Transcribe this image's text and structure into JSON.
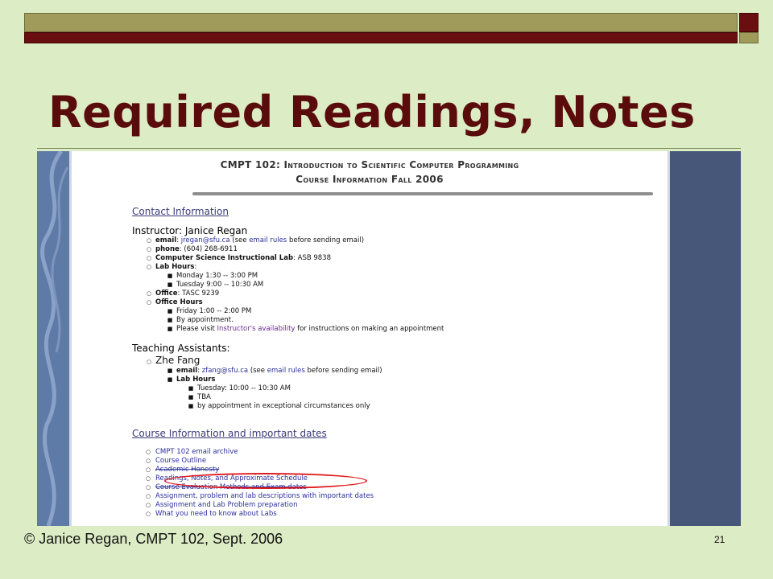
{
  "slide": {
    "title": "Required Readings, Notes",
    "footer": "© Janice Regan, CMPT 102, Sept. 2006",
    "page_number": "21",
    "colors": {
      "background": "#dcecc4",
      "title": "#5a0c0c",
      "olive_bar": "#a09b5a",
      "maroon_bar": "#6a0f10",
      "highlight_oval": "#e01a1a"
    }
  },
  "webpage": {
    "header_line1": "CMPT 102: Introduction to Scientific Computer Programming",
    "header_line2": "Course Information Fall 2006",
    "contact": {
      "section_title": "Contact Information",
      "instructor_heading": "Instructor: Janice Regan",
      "email_label": "email",
      "email_value": "jregan@sfu.ca",
      "email_pre": "(see",
      "email_rules_link": "email rules",
      "email_post": "before sending email)",
      "phone_label": "phone",
      "phone_value": "(604) 268-6911",
      "lab_label": "Computer Science Instructional Lab",
      "lab_value": "ASB 9838",
      "lab_hours_label": "Lab Hours",
      "lab_hours": [
        "Monday 1:30 -- 3:00 PM",
        "Tuesday 9:00 -- 10:30 AM"
      ],
      "office_label": "Office",
      "office_value": "TASC 9239",
      "office_hours_label": "Office Hours",
      "office_hours": [
        "Friday 1:00 -- 2:00 PM",
        "By appointment."
      ],
      "visit_pre": "Please visit",
      "visit_link": "Instructor's availability",
      "visit_post": "for instructions on making an appointment"
    },
    "ta": {
      "heading": "Teaching Assistants:",
      "name": "Zhe Fang",
      "email_label": "email",
      "email_value": "zfang@sfu.ca",
      "email_pre": "(see",
      "email_rules_link": "email rules",
      "email_post": "before sending email)",
      "lab_hours_label": "Lab Hours",
      "lab_hours": [
        "Tuesday: 10:00 -- 10:30 AM",
        "TBA",
        "by appointment in exceptional circumstances only"
      ]
    },
    "course": {
      "section_title": "Course Information and important dates",
      "links": [
        "CMPT 102 email archive",
        "Course Outline",
        "Academic Honesty",
        "Readings, Notes, and Approximate Schedule",
        "Course Evaluation Methods and Exam dates",
        "Assignment, problem and lab descriptions with important dates",
        "Assignment and Lab Problem preparation",
        "What you need to know about Labs"
      ],
      "highlighted_link_index": 3
    }
  }
}
